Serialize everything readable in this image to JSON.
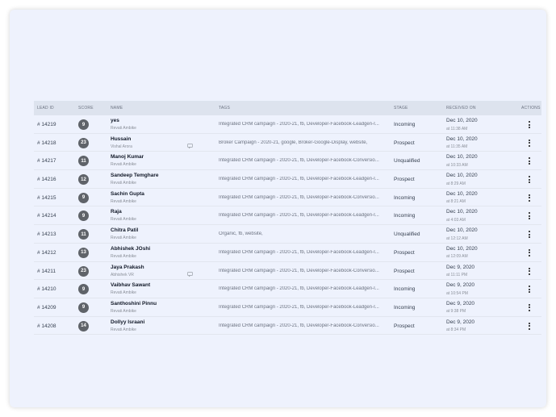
{
  "table": {
    "headers": {
      "lead_id": "LEAD ID",
      "score": "SCORE",
      "name": "NAME",
      "tags": "TAGS",
      "stage": "STAGE",
      "received_on": "RECEIVED ON",
      "actions": "ACTIONS"
    },
    "rows": [
      {
        "id": "# 14219",
        "score": "9",
        "name": "yes",
        "sub": "Revati Ambike",
        "tags": "Integrated CRM campaign - 2020-21, fb, Developer-Facebook-Leadgen-I...",
        "stage": "Incoming",
        "date": "Dec 10, 2020",
        "time": "at 11:38 AM",
        "icon": ""
      },
      {
        "id": "# 14218",
        "score": "23",
        "name": "Hussain",
        "sub": "Vishal Arora",
        "tags": "Broker Campaign - 2020-21, google, Broker-Google-Display, website,",
        "stage": "Prospect",
        "date": "Dec 10, 2020",
        "time": "at 11:35 AM",
        "icon": "message-icon"
      },
      {
        "id": "# 14217",
        "score": "11",
        "name": "Manoj Kumar",
        "sub": "Revati Ambike",
        "tags": "Integrated CRM campaign - 2020-21, fb, Developer-Facebook-Conversio...",
        "stage": "Unqualified",
        "date": "Dec 10, 2020",
        "time": "at 10:33 AM",
        "icon": ""
      },
      {
        "id": "# 14216",
        "score": "12",
        "name": "Sandeep Temghare",
        "sub": "Revati Ambike",
        "tags": "Integrated CRM campaign - 2020-21, fb, Developer-Facebook-Leadgen-I...",
        "stage": "Prospect",
        "date": "Dec 10, 2020",
        "time": "at 8:29 AM",
        "icon": ""
      },
      {
        "id": "# 14215",
        "score": "9",
        "name": "Sachin Gupta",
        "sub": "Revati Ambike",
        "tags": "Integrated CRM campaign - 2020-21, fb, Developer-Facebook-Conversio...",
        "stage": "Incoming",
        "date": "Dec 10, 2020",
        "time": "at 8:21 AM",
        "icon": ""
      },
      {
        "id": "# 14214",
        "score": "9",
        "name": "Raja",
        "sub": "Revati Ambike",
        "tags": "Integrated CRM campaign - 2020-21, fb, Developer-Facebook-Leadgen-I...",
        "stage": "Incoming",
        "date": "Dec 10, 2020",
        "time": "at 4:03 AM",
        "icon": ""
      },
      {
        "id": "# 14213",
        "score": "11",
        "name": "Chitra Patil",
        "sub": "Revati Ambike",
        "tags": "Organic, fb, website,",
        "stage": "Unqualified",
        "date": "Dec 10, 2020",
        "time": "at 12:12 AM",
        "icon": ""
      },
      {
        "id": "# 14212",
        "score": "13",
        "name": "Abhishek JOshi",
        "sub": "Revati Ambike",
        "tags": "Integrated CRM campaign - 2020-21, fb, Developer-Facebook-Leadgen-I...",
        "stage": "Prospect",
        "date": "Dec 10, 2020",
        "time": "at 12:09 AM",
        "icon": ""
      },
      {
        "id": "# 14211",
        "score": "23",
        "name": "Jaya Prakash",
        "sub": "Abhishek VR",
        "tags": "Integrated CRM campaign - 2020-21, fb, Developer-Facebook-Conversio...",
        "stage": "Prospect",
        "date": "Dec 9, 2020",
        "time": "at 11:11 PM",
        "icon": "message-icon"
      },
      {
        "id": "# 14210",
        "score": "9",
        "name": "Vaibhav Sawant",
        "sub": "Revati Ambike",
        "tags": "Integrated CRM campaign - 2020-21, fb, Developer-Facebook-Leadgen-I...",
        "stage": "Incoming",
        "date": "Dec 9, 2020",
        "time": "at 10:54 PM",
        "icon": ""
      },
      {
        "id": "# 14209",
        "score": "9",
        "name": "Santhoshini Pinnu",
        "sub": "Revati Ambike",
        "tags": "Integrated CRM campaign - 2020-21, fb, Developer-Facebook-Leadgen-I...",
        "stage": "Incoming",
        "date": "Dec 9, 2020",
        "time": "at 9:38 PM",
        "icon": ""
      },
      {
        "id": "# 14208",
        "score": "14",
        "name": "Dollyy Israani",
        "sub": "Revati Ambike",
        "tags": "Integrated CRM campaign - 2020-21, fb, Developer-Facebook-Conversio...",
        "stage": "Prospect",
        "date": "Dec 9, 2020",
        "time": "at 8:34 PM",
        "icon": ""
      }
    ]
  },
  "colors": {
    "background": "#eef2fd",
    "header_bg": "#dde3ee",
    "score_badge": "#5f6369"
  }
}
